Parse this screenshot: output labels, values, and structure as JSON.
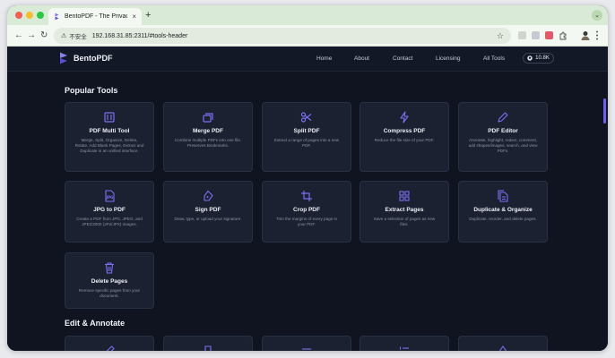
{
  "browser": {
    "tab_title": "BentoPDF - The Privacy First",
    "tab_close": "×",
    "new_tab": "+",
    "tab_menu": "⌄",
    "nav": {
      "back": "←",
      "forward": "→",
      "reload": "↻"
    },
    "security_icon": "⚠",
    "security_label": "不安全",
    "url": "192.168.31.85:2311/#tools-header",
    "star": "☆"
  },
  "site": {
    "brand": "BentoPDF",
    "nav_links": [
      "Home",
      "About",
      "Contact",
      "Licensing",
      "All Tools"
    ],
    "github_stars": "10.8K",
    "accent": "#7c6ff2"
  },
  "sections": [
    {
      "title": "Popular Tools",
      "tools": [
        {
          "title": "PDF Multi Tool",
          "desc": "Merge, Split, Organize, Delete, Rotate, Add Blank Pages, Extract and Duplicate in an unified interface.",
          "icon": "multi-tool-icon"
        },
        {
          "title": "Merge PDF",
          "desc": "Combine multiple PDFs into one file. Preserves Bookmarks.",
          "icon": "merge-icon"
        },
        {
          "title": "Split PDF",
          "desc": "Extract a range of pages into a new PDF.",
          "icon": "scissors-icon"
        },
        {
          "title": "Compress PDF",
          "desc": "Reduce the file size of your PDF.",
          "icon": "lightning-icon"
        },
        {
          "title": "PDF Editor",
          "desc": "Annotate, highlight, redact, comment, add shapes/images, search, and view PDFs.",
          "icon": "pencil-icon"
        },
        {
          "title": "JPG to PDF",
          "desc": "Create a PDF from JPG, JPEG, and JPEG2000 (JP2/JPX) images.",
          "icon": "jpg-file-icon"
        },
        {
          "title": "Sign PDF",
          "desc": "Draw, type, or upload your signature.",
          "icon": "pen-nib-icon"
        },
        {
          "title": "Crop PDF",
          "desc": "Trim the margins of every page in your PDF.",
          "icon": "crop-icon"
        },
        {
          "title": "Extract Pages",
          "desc": "Save a selection of pages as new files.",
          "icon": "grid-icon"
        },
        {
          "title": "Duplicate & Organize",
          "desc": "Duplicate, reorder, and delete pages.",
          "icon": "documents-icon"
        },
        {
          "title": "Delete Pages",
          "desc": "Remove specific pages from your document.",
          "icon": "trash-icon"
        }
      ]
    },
    {
      "title": "Edit & Annotate",
      "tools": []
    }
  ]
}
